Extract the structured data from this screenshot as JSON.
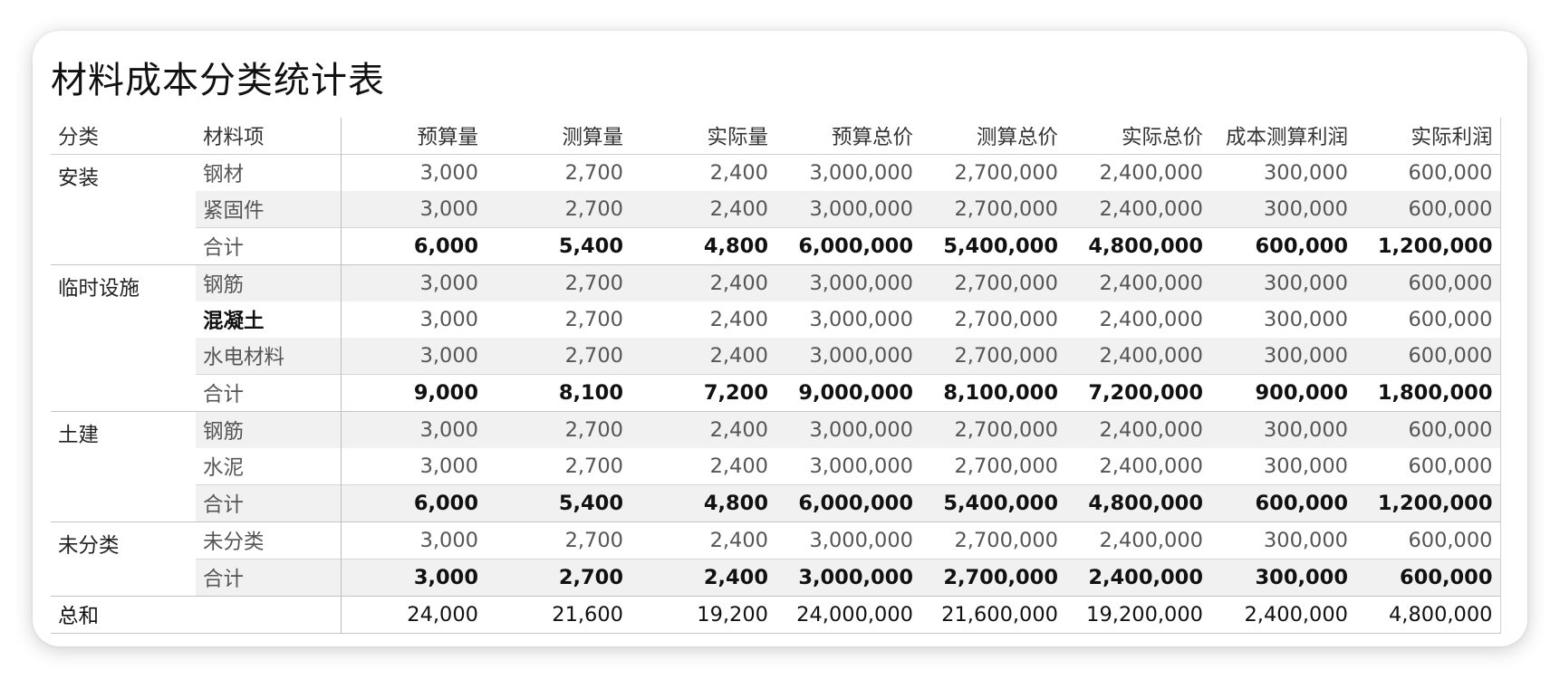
{
  "title": "材料成本分类统计表",
  "headers": [
    "分类",
    "材料项",
    "预算量",
    "测算量",
    "实际量",
    "预算总价",
    "测算总价",
    "实际总价",
    "成本测算利润",
    "实际利润"
  ],
  "groups": [
    {
      "category": "安装",
      "rows": [
        {
          "item": "钢材",
          "values": [
            "3,000",
            "2,700",
            "2,400",
            "3,000,000",
            "2,700,000",
            "2,400,000",
            "300,000",
            "600,000"
          ]
        },
        {
          "item": "紧固件",
          "values": [
            "3,000",
            "2,700",
            "2,400",
            "3,000,000",
            "2,700,000",
            "2,400,000",
            "300,000",
            "600,000"
          ]
        }
      ],
      "subtotal": {
        "item": "合计",
        "values": [
          "6,000",
          "5,400",
          "4,800",
          "6,000,000",
          "5,400,000",
          "4,800,000",
          "600,000",
          "1,200,000"
        ]
      }
    },
    {
      "category": "临时设施",
      "rows": [
        {
          "item": "钢筋",
          "values": [
            "3,000",
            "2,700",
            "2,400",
            "3,000,000",
            "2,700,000",
            "2,400,000",
            "300,000",
            "600,000"
          ]
        },
        {
          "item": "混凝土",
          "values": [
            "3,000",
            "2,700",
            "2,400",
            "3,000,000",
            "2,700,000",
            "2,400,000",
            "300,000",
            "600,000"
          ]
        },
        {
          "item": "水电材料",
          "values": [
            "3,000",
            "2,700",
            "2,400",
            "3,000,000",
            "2,700,000",
            "2,400,000",
            "300,000",
            "600,000"
          ]
        }
      ],
      "subtotal": {
        "item": "合计",
        "values": [
          "9,000",
          "8,100",
          "7,200",
          "9,000,000",
          "8,100,000",
          "7,200,000",
          "900,000",
          "1,800,000"
        ]
      }
    },
    {
      "category": "土建",
      "rows": [
        {
          "item": "钢筋",
          "values": [
            "3,000",
            "2,700",
            "2,400",
            "3,000,000",
            "2,700,000",
            "2,400,000",
            "300,000",
            "600,000"
          ]
        },
        {
          "item": "水泥",
          "values": [
            "3,000",
            "2,700",
            "2,400",
            "3,000,000",
            "2,700,000",
            "2,400,000",
            "300,000",
            "600,000"
          ]
        }
      ],
      "subtotal": {
        "item": "合计",
        "values": [
          "6,000",
          "5,400",
          "4,800",
          "6,000,000",
          "5,400,000",
          "4,800,000",
          "600,000",
          "1,200,000"
        ]
      }
    },
    {
      "category": "未分类",
      "rows": [
        {
          "item": "未分类",
          "values": [
            "3,000",
            "2,700",
            "2,400",
            "3,000,000",
            "2,700,000",
            "2,400,000",
            "300,000",
            "600,000"
          ]
        }
      ],
      "subtotal": {
        "item": "合计",
        "values": [
          "3,000",
          "2,700",
          "2,400",
          "3,000,000",
          "2,700,000",
          "2,400,000",
          "300,000",
          "600,000"
        ]
      }
    }
  ],
  "grand_total": {
    "label": "总和",
    "values": [
      "24,000",
      "21,600",
      "19,200",
      "24,000,000",
      "21,600,000",
      "19,200,000",
      "2,400,000",
      "4,800,000"
    ]
  }
}
